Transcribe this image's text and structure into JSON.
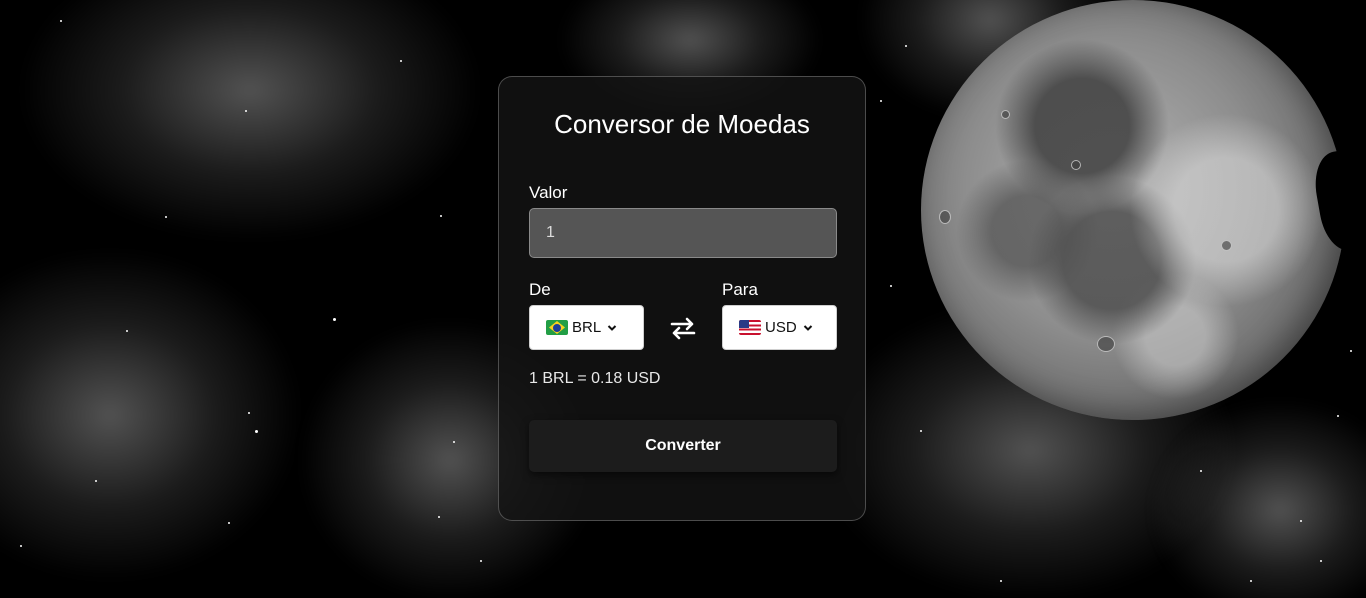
{
  "converter": {
    "title": "Conversor de Moedas",
    "amount_label": "Valor",
    "amount_value": "1",
    "from_label": "De",
    "to_label": "Para",
    "from_currency": {
      "code": "BRL",
      "flag": "brazil-flag"
    },
    "to_currency": {
      "code": "USD",
      "flag": "usa-flag"
    },
    "swap_icon": "swap-arrows-icon",
    "rate_text": "1 BRL = 0.18 USD",
    "convert_label": "Converter"
  },
  "background": {
    "theme": "night-sky-with-moon",
    "colors": {
      "sky": "#000000",
      "card": "#141414",
      "input": "#555555"
    }
  }
}
